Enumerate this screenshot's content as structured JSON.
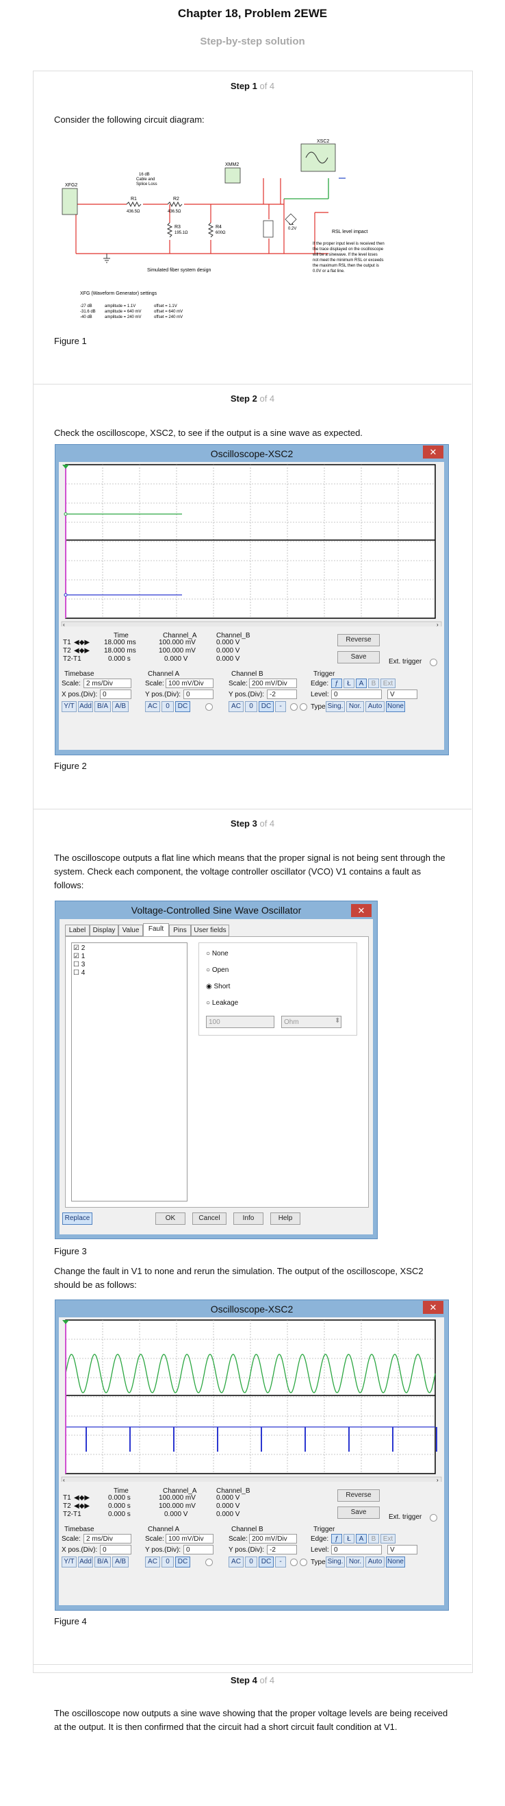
{
  "header": {
    "title": "Chapter 18, Problem 2EWE",
    "subtitle": "Step-by-step solution"
  },
  "steps": [
    {
      "label": "Step 1",
      "of": "of 4"
    },
    {
      "label": "Step 2",
      "of": "of 4"
    },
    {
      "label": "Step 3",
      "of": "of 4"
    },
    {
      "label": "Step 4",
      "of": "of 4"
    }
  ],
  "step1": {
    "text": "Consider the following circuit diagram:",
    "figure": "Figure 1",
    "circuit": {
      "xfg": "XFG2",
      "xsc": "XSC2",
      "xmm": "XMM2",
      "cable": [
        "16 dB",
        "Cable and",
        "Splice Loss"
      ],
      "r1": "R1",
      "r1v": "436.5Ω",
      "r2": "R2",
      "r2v": "436.5Ω",
      "r3": "R3",
      "r3v": "195.1Ω",
      "r4": "R4",
      "r4v": "600Ω",
      "v1": "V1",
      "v1v": "0.2V",
      "design": "Simulated fiber system design",
      "rsl_title": "RSL level impact",
      "rsl_lines": [
        "If the proper input level is received then",
        "the trace displayed on the oscilloscope",
        "will be a sinewave.  If the level loses",
        "not meet the minimum RSL or exceeds",
        "the maximum RSL then the output is",
        "0.0V or a flat line."
      ],
      "xfg_title": "XFG (Waveform Generator) settings",
      "xfg_rows": [
        [
          "-27 dB",
          "amplitude = 1.1V",
          "offset = 1.1V"
        ],
        [
          "-31.6 dB",
          "amplitude = 640 mV",
          "offset = 640 mV"
        ],
        [
          "-40 dB",
          "amplitude = 240 mV",
          "offset = 240 mV"
        ]
      ]
    }
  },
  "step2": {
    "text": "Check the oscilloscope, XSC2, to see if the output is a sine wave as expected.",
    "figure": "Figure 2"
  },
  "step3": {
    "text": "The oscilloscope outputs a flat line which means that the proper signal is not being sent through the system. Check each component, the voltage controller oscillator (VCO) V1 contains a fault as follows:",
    "figure": "Figure 3",
    "text2": "Change the fault in V1 to none and rerun the simulation. The output of the oscilloscope, XSC2 should be as follows:",
    "figure2": "Figure 4"
  },
  "step4": {
    "text": "The oscilloscope now outputs a sine wave showing that the proper voltage levels are being received at the output. It is then confirmed that the circuit had a short circuit fault condition at V1."
  },
  "scope": {
    "title": "Oscilloscope-XSC2",
    "close": "✕",
    "headers": {
      "time": "Time",
      "a": "Channel_A",
      "b": "Channel_B"
    },
    "rows_fig2": [
      [
        "T1",
        "18.000 ms",
        "100.000 mV",
        "0.000 V"
      ],
      [
        "T2",
        "18.000 ms",
        "100.000 mV",
        "0.000 V"
      ],
      [
        "T2-T1",
        "0.000 s",
        "0.000 V",
        "0.000 V"
      ]
    ],
    "rows_fig4": [
      [
        "T1",
        "0.000 s",
        "100.000 mV",
        "0.000 V"
      ],
      [
        "T2",
        "0.000 s",
        "100.000 mV",
        "0.000 V"
      ],
      [
        "T2-T1",
        "0.000 s",
        "0.000 V",
        "0.000 V"
      ]
    ],
    "reverse": "Reverse",
    "save": "Save",
    "ext_trigger": "Ext. trigger",
    "timebase": {
      "label": "Timebase",
      "scale_label": "Scale:",
      "scale": "2 ms/Div",
      "xpos_label": "X pos.(Div):",
      "xpos": "0",
      "buttons": [
        "Y/T",
        "Add",
        "B/A",
        "A/B"
      ]
    },
    "channel_a": {
      "label": "Channel A",
      "scale_label": "Scale:",
      "scale": "100 mV/Div",
      "ypos_label": "Y pos.(Div):",
      "ypos": "0",
      "buttons": [
        "AC",
        "0",
        "DC"
      ]
    },
    "channel_b": {
      "label": "Channel B",
      "scale_label": "Scale:",
      "scale": "200 mV/Div",
      "ypos_label": "Y pos.(Div):",
      "ypos": "-2",
      "buttons": [
        "AC",
        "0",
        "DC",
        "-"
      ]
    },
    "trigger": {
      "label": "Trigger",
      "edge_label": "Edge:",
      "edge_buttons": [
        "A",
        "B",
        "Ext"
      ],
      "level_label": "Level:",
      "level": "0",
      "level_unit": "V",
      "type_label": "Type",
      "type_buttons": [
        "Sing.",
        "Nor.",
        "Auto",
        "None"
      ]
    }
  },
  "vco": {
    "title": "Voltage-Controlled Sine Wave Oscillator",
    "close": "✕",
    "tabs": [
      "Label",
      "Display",
      "Value",
      "Fault",
      "Pins",
      "User fields"
    ],
    "active_tab": "Fault",
    "pins": [
      {
        "label": "2",
        "checked": true
      },
      {
        "label": "1",
        "checked": true
      },
      {
        "label": "3",
        "checked": false
      },
      {
        "label": "4",
        "checked": false
      }
    ],
    "options": [
      "None",
      "Open",
      "Short",
      "Leakage"
    ],
    "selected": "Short",
    "leak_value": "100",
    "leak_unit": "Ohm",
    "buttons": {
      "replace": "Replace",
      "ok": "OK",
      "cancel": "Cancel",
      "info": "Info",
      "help": "Help"
    }
  }
}
